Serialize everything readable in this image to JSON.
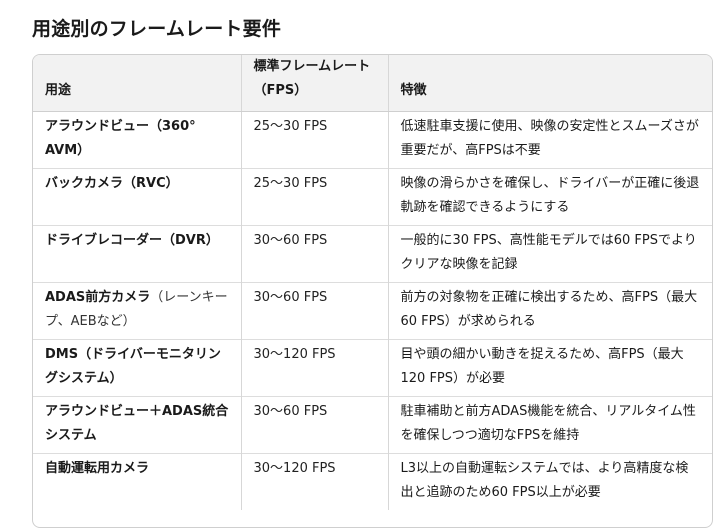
{
  "title": "用途別のフレームレート要件",
  "table": {
    "headers": [
      "用途",
      "標準フレームレート（FPS）",
      "特徴"
    ],
    "rows": [
      {
        "app": "アラウンドビュー（360° AVM）",
        "app_note": "",
        "fps": "25～30 FPS",
        "feature": "低速駐車支援に使用、映像の安定性とスムーズさが重要だが、高FPSは不要"
      },
      {
        "app": "バックカメラ（RVC）",
        "app_note": "",
        "fps": "25～30 FPS",
        "feature": "映像の滑らかさを確保し、ドライバーが正確に後退軌跡を確認できるようにする"
      },
      {
        "app": "ドライブレコーダー（DVR）",
        "app_note": "",
        "fps": "30～60 FPS",
        "feature": "一般的に30 FPS、高性能モデルでは60 FPSでよりクリアな映像を記録"
      },
      {
        "app": "ADAS前方カメラ",
        "app_note": "（レーンキープ、AEBなど）",
        "fps": "30～60 FPS",
        "feature": "前方の対象物を正確に検出するため、高FPS（最大60 FPS）が求められる"
      },
      {
        "app": "DMS（ドライバーモニタリングシステム）",
        "app_note": "",
        "fps": "30～120 FPS",
        "feature": "目や頭の細かい動きを捉えるため、高FPS（最大120 FPS）が必要"
      },
      {
        "app": "アラウンドビュー＋ADAS統合システム",
        "app_note": "",
        "fps": "30～60 FPS",
        "feature": "駐車補助と前方ADAS機能を統合、リアルタイム性を確保しつつ適切なFPSを維持"
      },
      {
        "app": "自動運転用カメラ",
        "app_note": "",
        "fps": "30～120 FPS",
        "feature": "L3以上の自動運転システムでは、より高精度な検出と追跡のため60 FPS以上が必要"
      }
    ]
  }
}
